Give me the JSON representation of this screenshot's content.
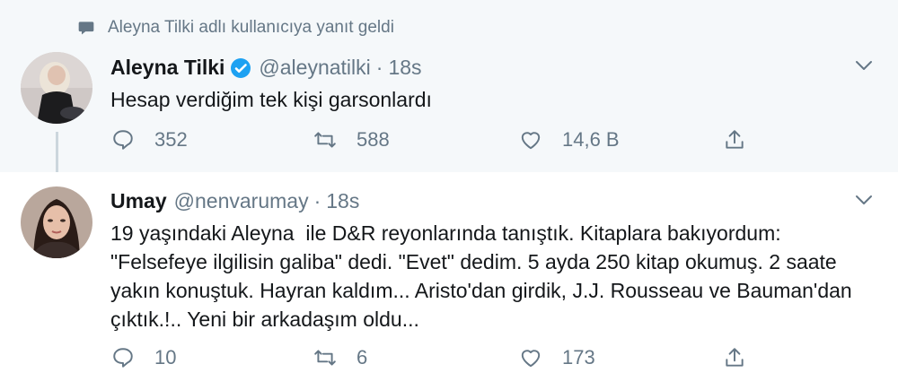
{
  "context_text": "Aleyna Tilki adlı kullanıcıya yanıt geldi",
  "tweets": [
    {
      "name": "Aleyna Tilki",
      "verified": true,
      "handle": "@aleynatilki",
      "dot": "·",
      "time": "18s",
      "text": "Hesap verdiğim tek kişi garsonlardı",
      "replies": "352",
      "retweets": "588",
      "likes": "14,6 B"
    },
    {
      "name": "Umay",
      "verified": false,
      "handle": "@nenvarumay",
      "dot": "·",
      "time": "18s",
      "text": "19 yaşındaki Aleyna  ile D&R reyonlarında tanıştık. Kitaplara bakıyordum: \"Felsefeye ilgilisin galiba\" dedi. \"Evet\" dedim. 5 ayda 250 kitap okumuş. 2 saate yakın konuştuk. Hayran kaldım... Aristo'dan girdik, J.J. Rousseau ve Bauman'dan çıktık.!.. Yeni bir arkadaşım oldu...",
      "replies": "10",
      "retweets": "6",
      "likes": "173"
    }
  ],
  "colors": {
    "accent": "#1da1f2",
    "muted": "#657786",
    "highlight_bg": "#f5f8fa"
  },
  "icons": [
    "speech-bubble-icon",
    "verified-badge-icon",
    "chevron-down-icon",
    "reply-icon",
    "retweet-icon",
    "like-icon",
    "share-icon"
  ]
}
